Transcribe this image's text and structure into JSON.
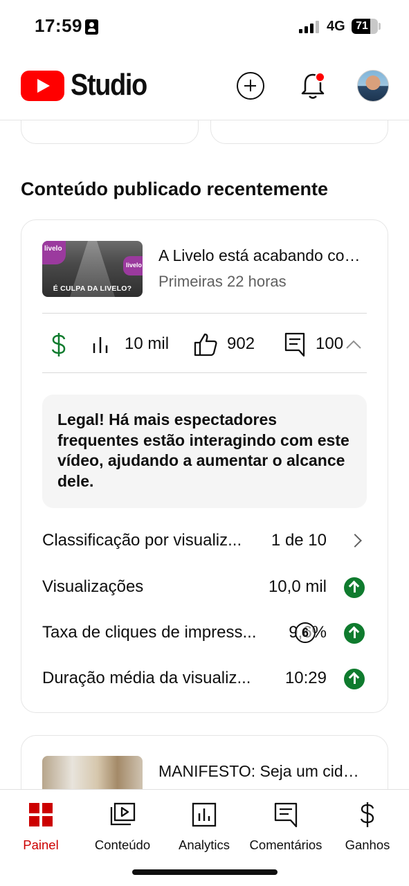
{
  "status_bar": {
    "time": "17:59",
    "network": "4G",
    "battery": "71"
  },
  "header": {
    "brand": "Studio"
  },
  "section": {
    "title": "Conteúdo publicado recentemente"
  },
  "video": {
    "thumbnail_caption": "É CULPA DA LIVELO?",
    "thumbnail_logo_text": "livelo",
    "title": "A Livelo está acabando com a milhagem?",
    "subtitle": "Primeiras 22 horas",
    "metrics": {
      "views": "10 mil",
      "likes": "902",
      "comments": "100"
    },
    "insight": "Legal! Há mais espectadores frequentes estão interagindo com este vídeo, ajudando a aumentar o alcance dele.",
    "stats": [
      {
        "label": "Classificação por visualiz...",
        "value": "1 de 10"
      },
      {
        "label": "Visualizações",
        "value": "10,0 mil"
      },
      {
        "label": "Taxa de cliques de impress...",
        "value": "9,6%"
      },
      {
        "label": "Duração média da visualiz...",
        "value": "10:29"
      }
    ],
    "counter_badge": "6"
  },
  "video2": {
    "title": "MANIFESTO: Seja um cidadão"
  },
  "nav": {
    "items": [
      {
        "label": "Painel"
      },
      {
        "label": "Conteúdo"
      },
      {
        "label": "Analytics"
      },
      {
        "label": "Comentários"
      },
      {
        "label": "Ganhos"
      }
    ]
  },
  "colors": {
    "brand_red": "#ff0000",
    "active_nav": "#cc0000",
    "trend_green": "#0f7b2e",
    "monetization_green": "#0f7b2e"
  }
}
